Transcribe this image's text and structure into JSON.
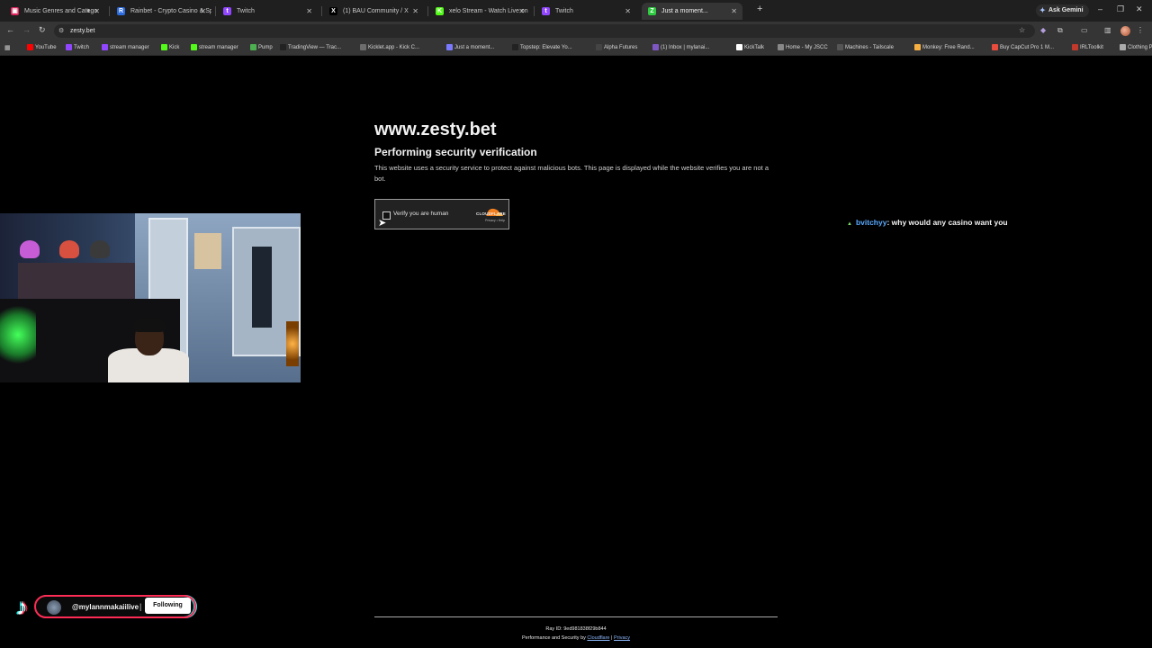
{
  "browser": {
    "tabs": [
      {
        "label": "Music Genres and Catego",
        "fav_color": "#e0245e",
        "fav_glyph": "▣",
        "muted": true
      },
      {
        "label": "Rainbet - Crypto Casino & Spo",
        "fav_color": "#2d6cdf",
        "fav_glyph": "R"
      },
      {
        "label": "Twitch",
        "fav_color": "#9146ff",
        "fav_glyph": "t"
      },
      {
        "label": "(1) BAU Community / X",
        "fav_color": "#000000",
        "fav_glyph": "X"
      },
      {
        "label": "xelo Stream - Watch Live on Ki",
        "fav_color": "#53fc18",
        "fav_glyph": "K"
      },
      {
        "label": "Twitch",
        "fav_color": "#9146ff",
        "fav_glyph": "t"
      },
      {
        "label": "Just a moment...",
        "fav_color": "#2ecc40",
        "fav_glyph": "Z",
        "active": true
      }
    ],
    "ask_gemini": "Ask Gemini",
    "url": "zesty.bet",
    "bookmarks": [
      {
        "label": "YouTube",
        "color": "#ff0000"
      },
      {
        "label": "Twitch",
        "color": "#9146ff"
      },
      {
        "label": "stream manager",
        "color": "#9146ff"
      },
      {
        "label": "Kick",
        "color": "#53fc18"
      },
      {
        "label": "stream manager",
        "color": "#53fc18"
      },
      {
        "label": "Pump",
        "color": "#4caf50"
      },
      {
        "label": "TradingView — Trac...",
        "color": "#222222"
      },
      {
        "label": "Kicklet.app - Kick C...",
        "color": "#6d6d6d"
      },
      {
        "label": "Just a moment...",
        "color": "#7a7aff"
      },
      {
        "label": "Topstep: Elevate Yo...",
        "color": "#222222"
      },
      {
        "label": "Alpha Futures",
        "color": "#444444"
      },
      {
        "label": "(1) Inbox | mylanai...",
        "color": "#7e57c2"
      },
      {
        "label": "KickTalk",
        "color": "#ffffff"
      },
      {
        "label": "Home - My JSCC",
        "color": "#888888"
      },
      {
        "label": "Machines - Tailscale",
        "color": "#555555"
      },
      {
        "label": "Monkey: Free Rand...",
        "color": "#f5b041"
      },
      {
        "label": "Buy CapCut Pro 1 M...",
        "color": "#e74c3c"
      },
      {
        "label": "IRLToolkit",
        "color": "#c0392b"
      },
      {
        "label": "Clothing Preview | D...",
        "color": "#aaaaaa"
      }
    ]
  },
  "page": {
    "site": "www.zesty.bet",
    "heading": "Performing security verification",
    "description": "This website uses a security service to protect against malicious bots. This page is displayed while the website verifies you are not a bot.",
    "checkbox_label": "Verify you are human",
    "cf_brand": "CLOUDFLARE",
    "cf_links": "Privacy • Help",
    "ray_id": "Ray ID: 9ed981838f29b844",
    "perf_prefix": "Performance and Security by",
    "perf_link": "Cloudflare",
    "perf_sep": "|",
    "privacy_link": "Privacy"
  },
  "overlay": {
    "chat_user": "bvitchyy",
    "chat_message": ": why would any casino want you",
    "tiktok_handle": "@mylannmakaiilive",
    "tiktok_sep": "|",
    "follow_label": "Following"
  }
}
